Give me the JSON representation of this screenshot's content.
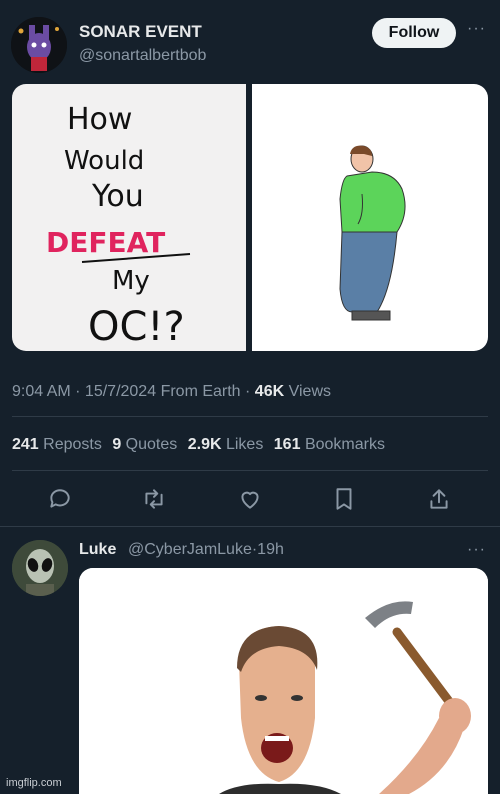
{
  "post": {
    "display_name": "SONAR EVENT",
    "handle": "@sonartalbertbob",
    "follow_label": "Follow",
    "more_label": "···",
    "media_left_text": [
      "How",
      "Would",
      "You",
      "DEFEAT",
      "My",
      "OC!?"
    ],
    "time": "9:04 AM",
    "date": "15/7/2024",
    "source": "From Earth",
    "views_count": "46K",
    "views_label": "Views",
    "stats": [
      {
        "count": "241",
        "label": "Reposts"
      },
      {
        "count": "9",
        "label": "Quotes"
      },
      {
        "count": "2.9K",
        "label": "Likes"
      },
      {
        "count": "161",
        "label": "Bookmarks"
      }
    ],
    "actions": [
      "reply-icon",
      "repost-icon",
      "like-icon",
      "bookmark-icon",
      "share-icon"
    ]
  },
  "reply": {
    "display_name": "Luke",
    "handle": "@CyberJamLuke",
    "age": "19h",
    "more_label": "···"
  },
  "watermark": "imgflip.com",
  "colors": {
    "background": "#15202b",
    "text_primary": "#e7e9ea",
    "text_secondary": "#8b98a5",
    "divider": "#2f3b47",
    "follow_bg": "#eff3f4",
    "defeat_red": "#e0245e"
  }
}
